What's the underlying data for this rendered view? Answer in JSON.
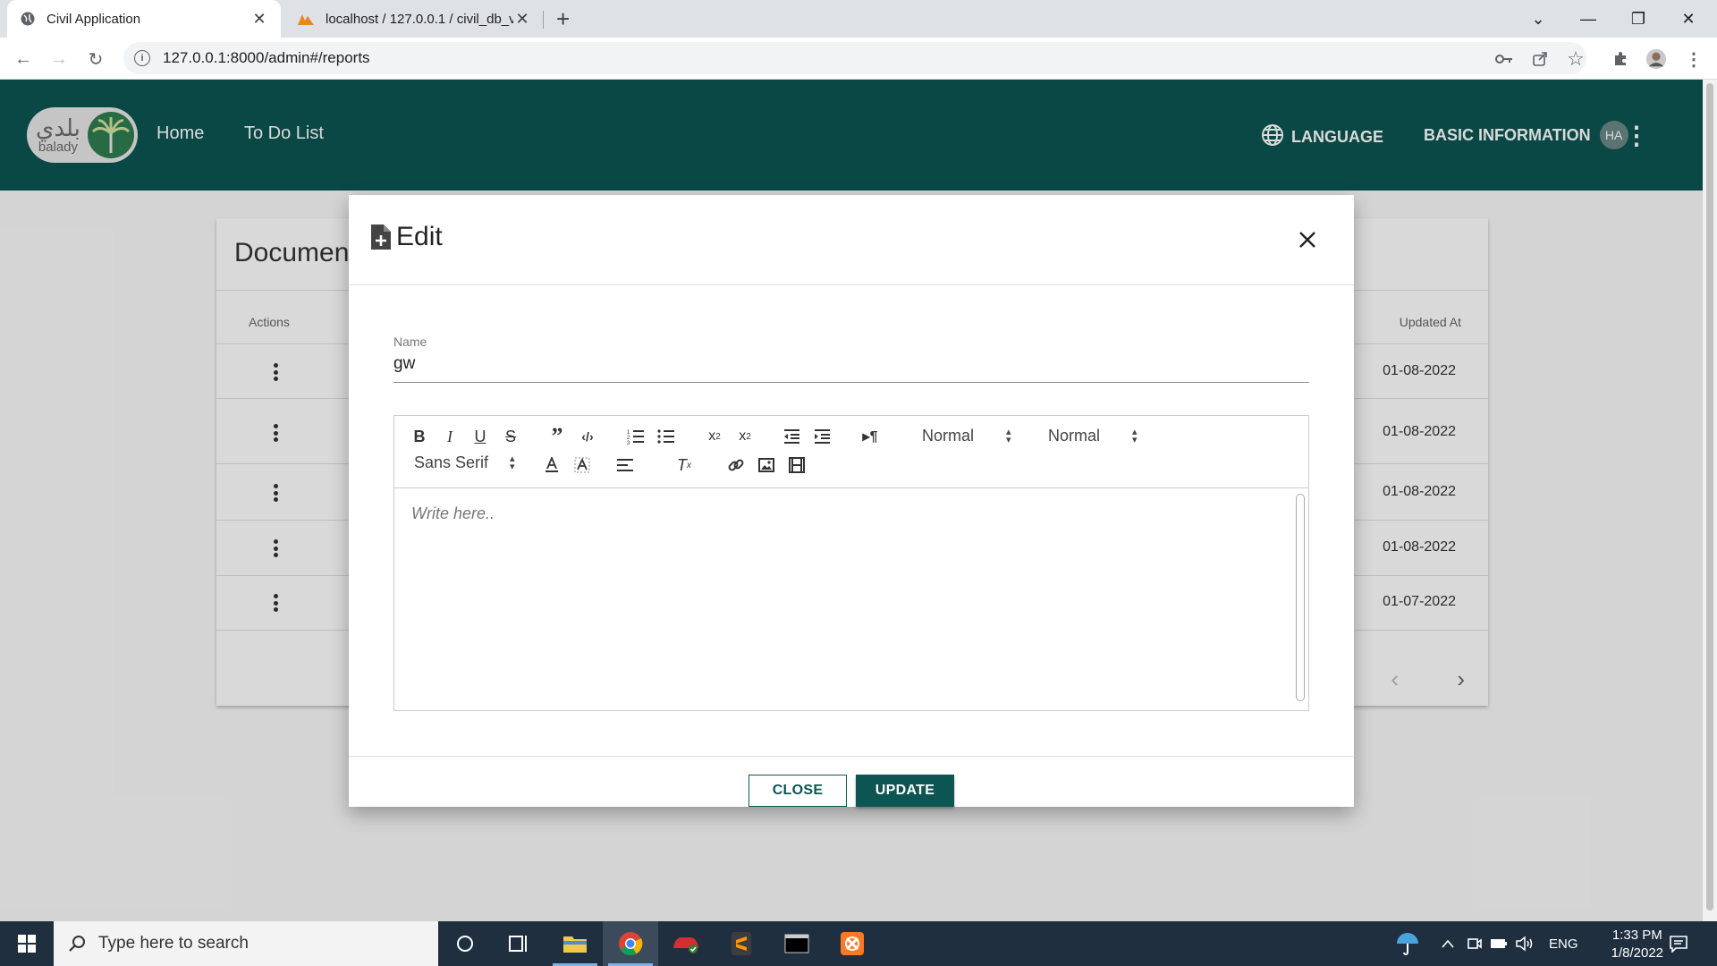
{
  "browser": {
    "tabs": [
      {
        "title": "Civil Application",
        "active": true
      },
      {
        "title": "localhost / 127.0.0.1 / civil_db_v6",
        "active": false
      }
    ],
    "url": "127.0.0.1:8000/admin#/reports"
  },
  "app": {
    "logo_arabic": "بلدي",
    "logo_english": "balady",
    "nav": [
      "Home",
      "To Do List"
    ],
    "language_label": "LANGUAGE",
    "basic_info_label": "BASIC INFORMATION",
    "avatar_initials": "HA"
  },
  "background_card": {
    "title": "Documen",
    "columns": {
      "actions": "Actions",
      "updated_at": "Updated At"
    },
    "rows": [
      {
        "updated_at": "01-08-2022"
      },
      {
        "updated_at": "01-08-2022"
      },
      {
        "updated_at": "01-08-2022"
      },
      {
        "updated_at": "01-08-2022"
      },
      {
        "updated_at": "01-07-2022"
      }
    ]
  },
  "dialog": {
    "title": "Edit",
    "name_label": "Name",
    "name_value": "gw",
    "editor": {
      "header_picker": "Normal",
      "size_picker": "Normal",
      "font_picker": "Sans Serif",
      "placeholder": "Write here.."
    },
    "close_label": "CLOSE",
    "update_label": "UPDATE"
  },
  "taskbar": {
    "search_placeholder": "Type here to search",
    "language": "ENG",
    "time": "1:33 PM",
    "date": "1/8/2022"
  },
  "colors": {
    "brand": "#0c5552",
    "taskbar": "#1f2f3f"
  }
}
